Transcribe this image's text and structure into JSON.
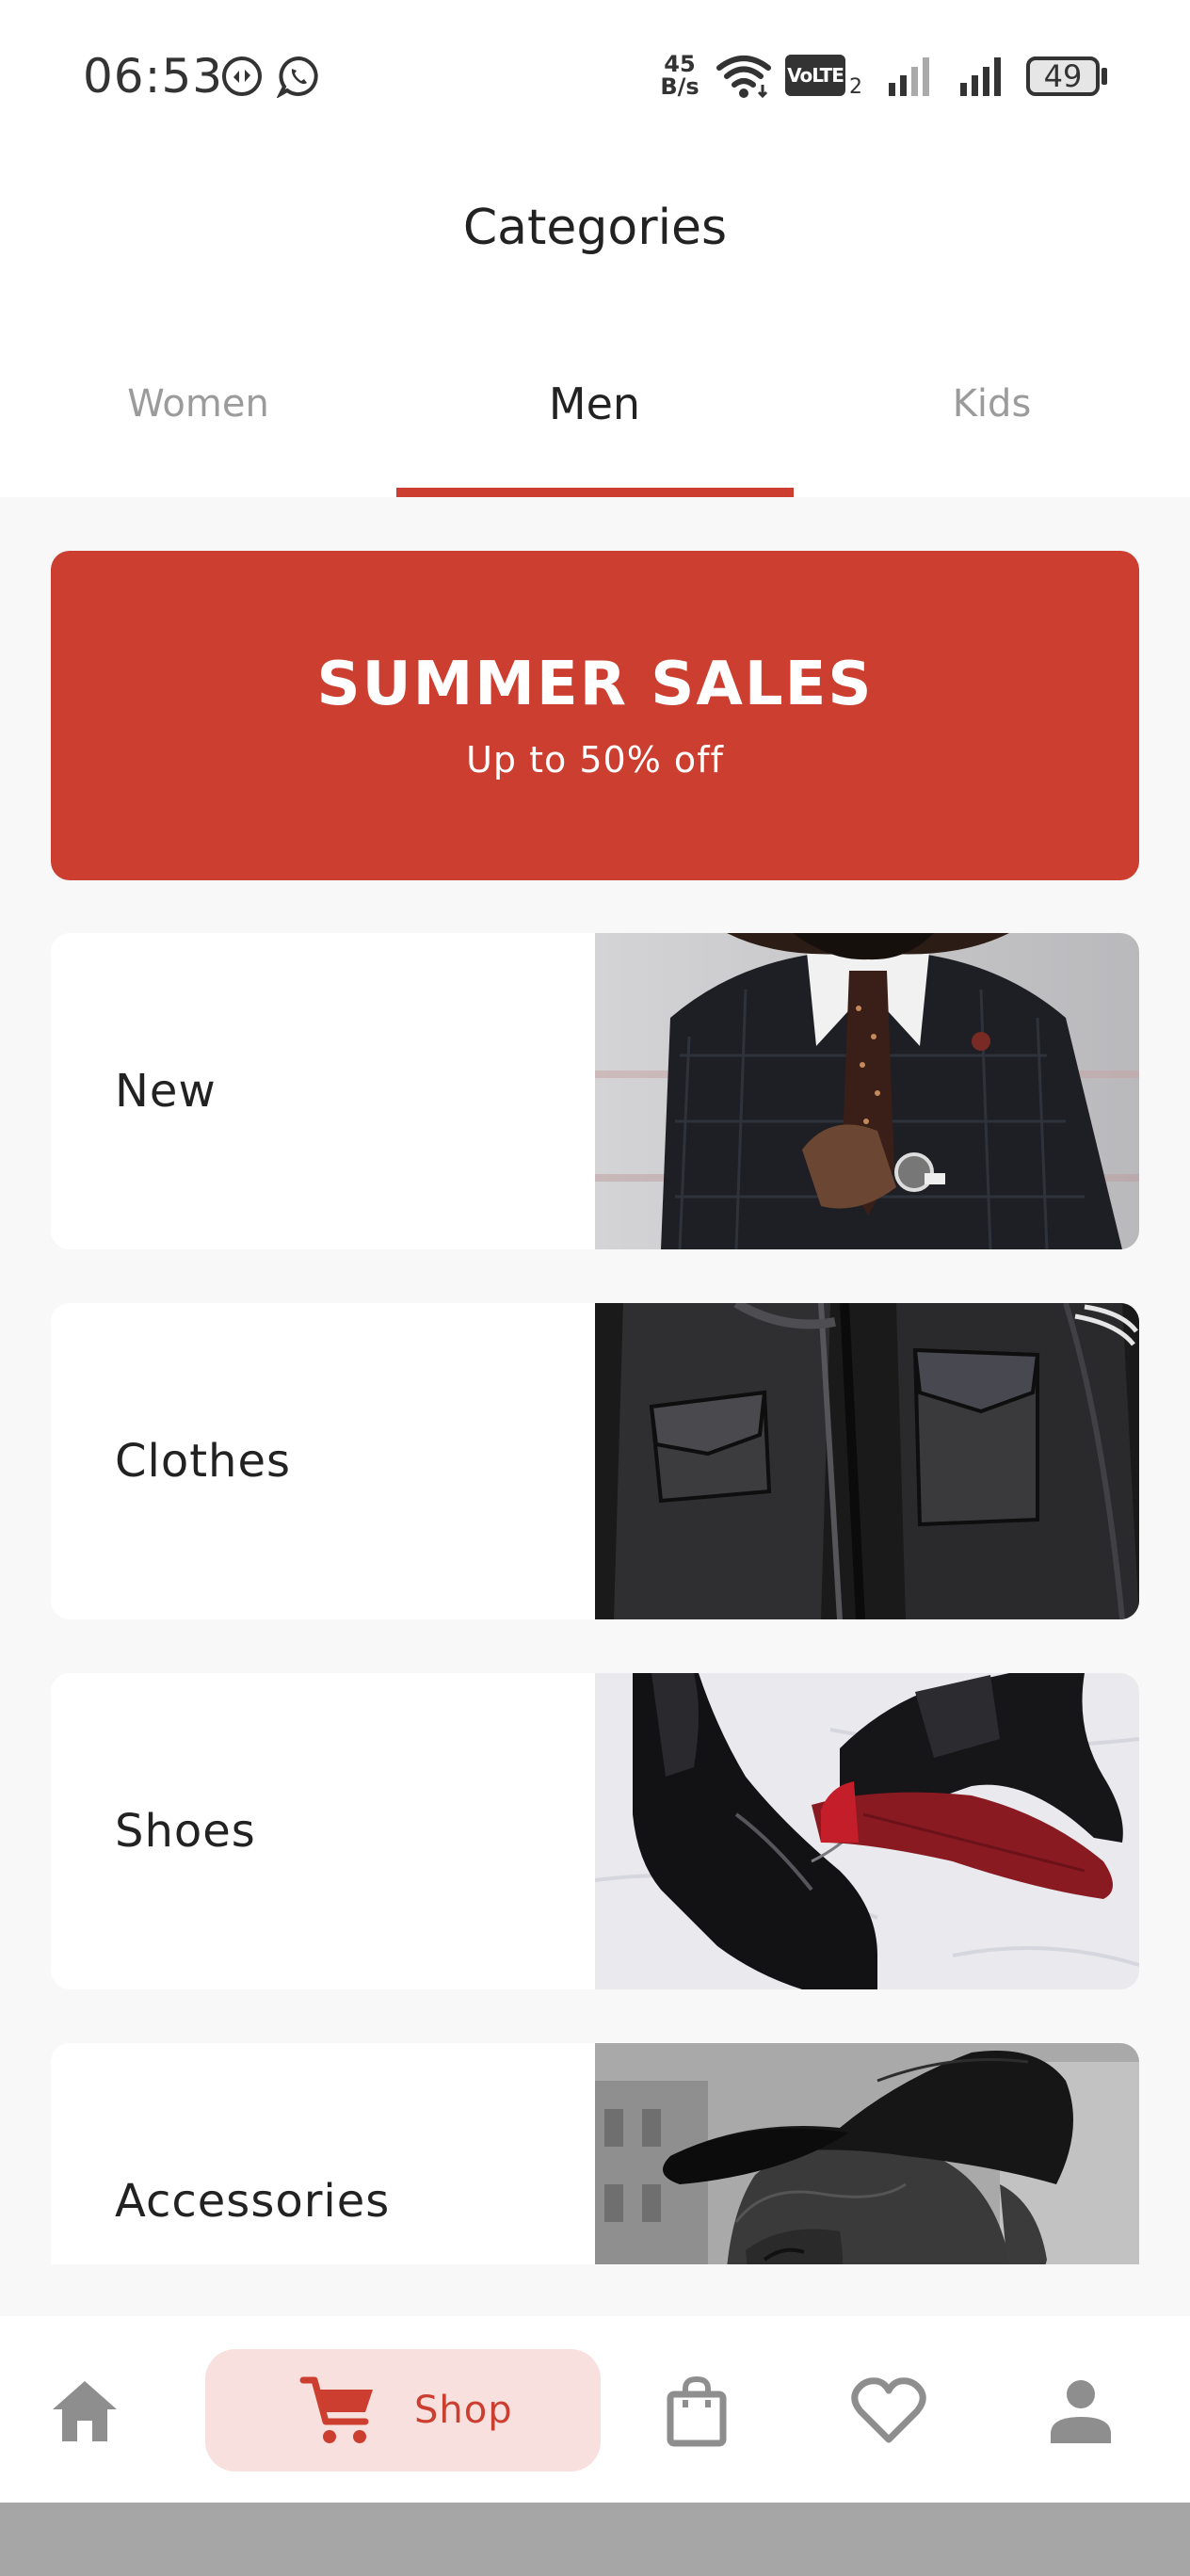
{
  "status_bar": {
    "time": "06:53",
    "net_speed_value": "45",
    "net_speed_unit": "B/s",
    "volte_label": "VoLTE",
    "sim_slot": "2",
    "battery_level": "49",
    "icons": [
      "data-saver-icon",
      "whatsapp-icon",
      "wifi-icon",
      "volte-icon",
      "signal-sim1-icon",
      "signal-sim2-icon",
      "battery-icon"
    ]
  },
  "header": {
    "title": "Categories"
  },
  "tabs": [
    {
      "label": "Women",
      "active": false
    },
    {
      "label": "Men",
      "active": true
    },
    {
      "label": "Kids",
      "active": false
    }
  ],
  "banner": {
    "title": "SUMMER SALES",
    "subtitle": "Up to 50% off"
  },
  "categories": [
    {
      "label": "New",
      "image": "man-in-suit-photo"
    },
    {
      "label": "Clothes",
      "image": "leather-jacket-photo"
    },
    {
      "label": "Shoes",
      "image": "chelsea-boots-photo"
    },
    {
      "label": "Accessories",
      "image": "man-in-cap-photo"
    }
  ],
  "bottom_nav": {
    "items": [
      {
        "id": "home",
        "icon": "home-icon",
        "active": false
      },
      {
        "id": "shop",
        "icon": "cart-icon",
        "label": "Shop",
        "active": true
      },
      {
        "id": "bag",
        "icon": "bag-icon",
        "active": false
      },
      {
        "id": "favorites",
        "icon": "heart-icon",
        "active": false
      },
      {
        "id": "profile",
        "icon": "person-icon",
        "active": false
      }
    ]
  },
  "colors": {
    "accent": "#cc3f30",
    "active_tab_background": "#f8e0de",
    "inactive_icon": "#8e8e8e",
    "page_background": "#f8f8f8"
  }
}
